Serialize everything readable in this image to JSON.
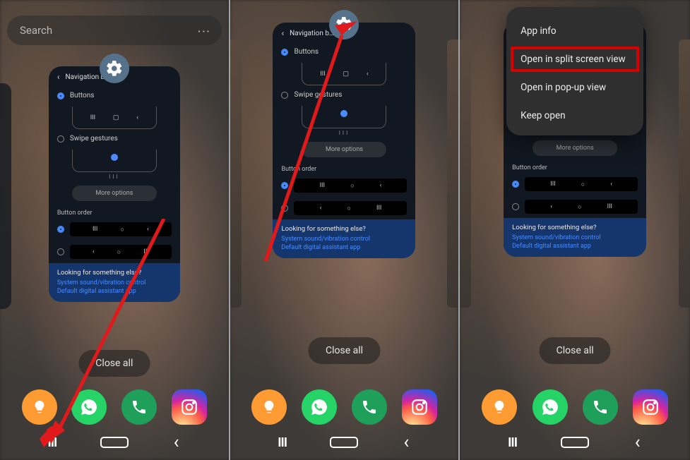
{
  "search_placeholder": "Search",
  "app_icon_semantic": "settings-gear-icon",
  "card": {
    "header": "Navigation b…",
    "header_full": "Navigation bar",
    "opt_buttons": "Buttons",
    "opt_swipe": "Swipe gestures",
    "more_options": "More options",
    "button_order": "Button order",
    "footer_title": "Looking for something else?",
    "footer_link1": "System sound/vibration control",
    "footer_link2": "Default digital assistant app"
  },
  "close_all": "Close all",
  "context_menu": {
    "app_info": "App info",
    "split": "Open in split screen view",
    "popup": "Open in pop-up view",
    "keep": "Keep open"
  },
  "dock_apps": [
    "tips-bulb",
    "whatsapp",
    "phone",
    "instagram"
  ],
  "navbar_glyphs": {
    "recents": "III",
    "back": "‹"
  }
}
